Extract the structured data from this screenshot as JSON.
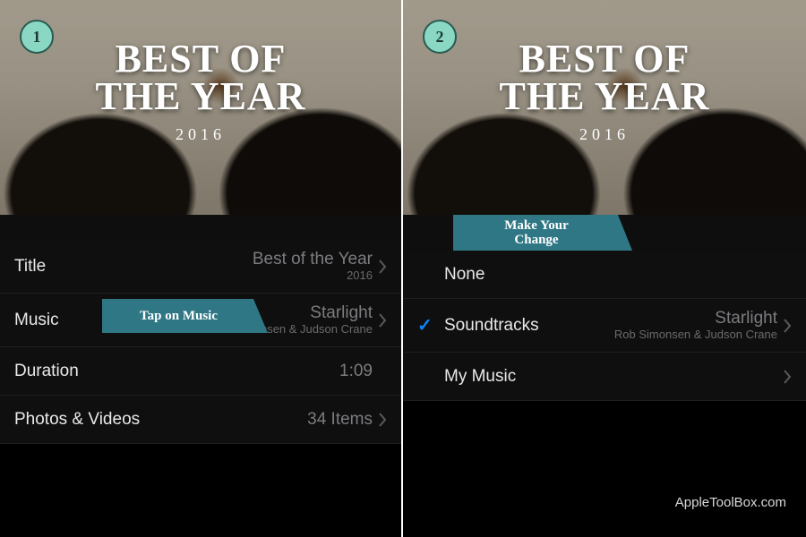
{
  "hero": {
    "title_line1": "BEST OF",
    "title_line2": "THE YEAR",
    "year": "2016"
  },
  "steps": {
    "one": "1",
    "two": "2"
  },
  "callouts": {
    "tap_music": "Tap on Music",
    "make_change_l1": "Make Your",
    "make_change_l2": "Change"
  },
  "left": {
    "title_label": "Title",
    "title_value": "Best of the Year",
    "title_sub": "2016",
    "music_label": "Music",
    "music_value": "Starlight",
    "music_sub": "Rob Simonsen & Judson Crane",
    "duration_label": "Duration",
    "duration_value": "1:09",
    "photos_label": "Photos & Videos",
    "photos_value": "34 Items"
  },
  "right": {
    "none_label": "None",
    "soundtracks_label": "Soundtracks",
    "soundtracks_value": "Starlight",
    "soundtracks_sub": "Rob Simonsen & Judson Crane",
    "mymusic_label": "My Music"
  },
  "watermark": "AppleToolBox.com"
}
